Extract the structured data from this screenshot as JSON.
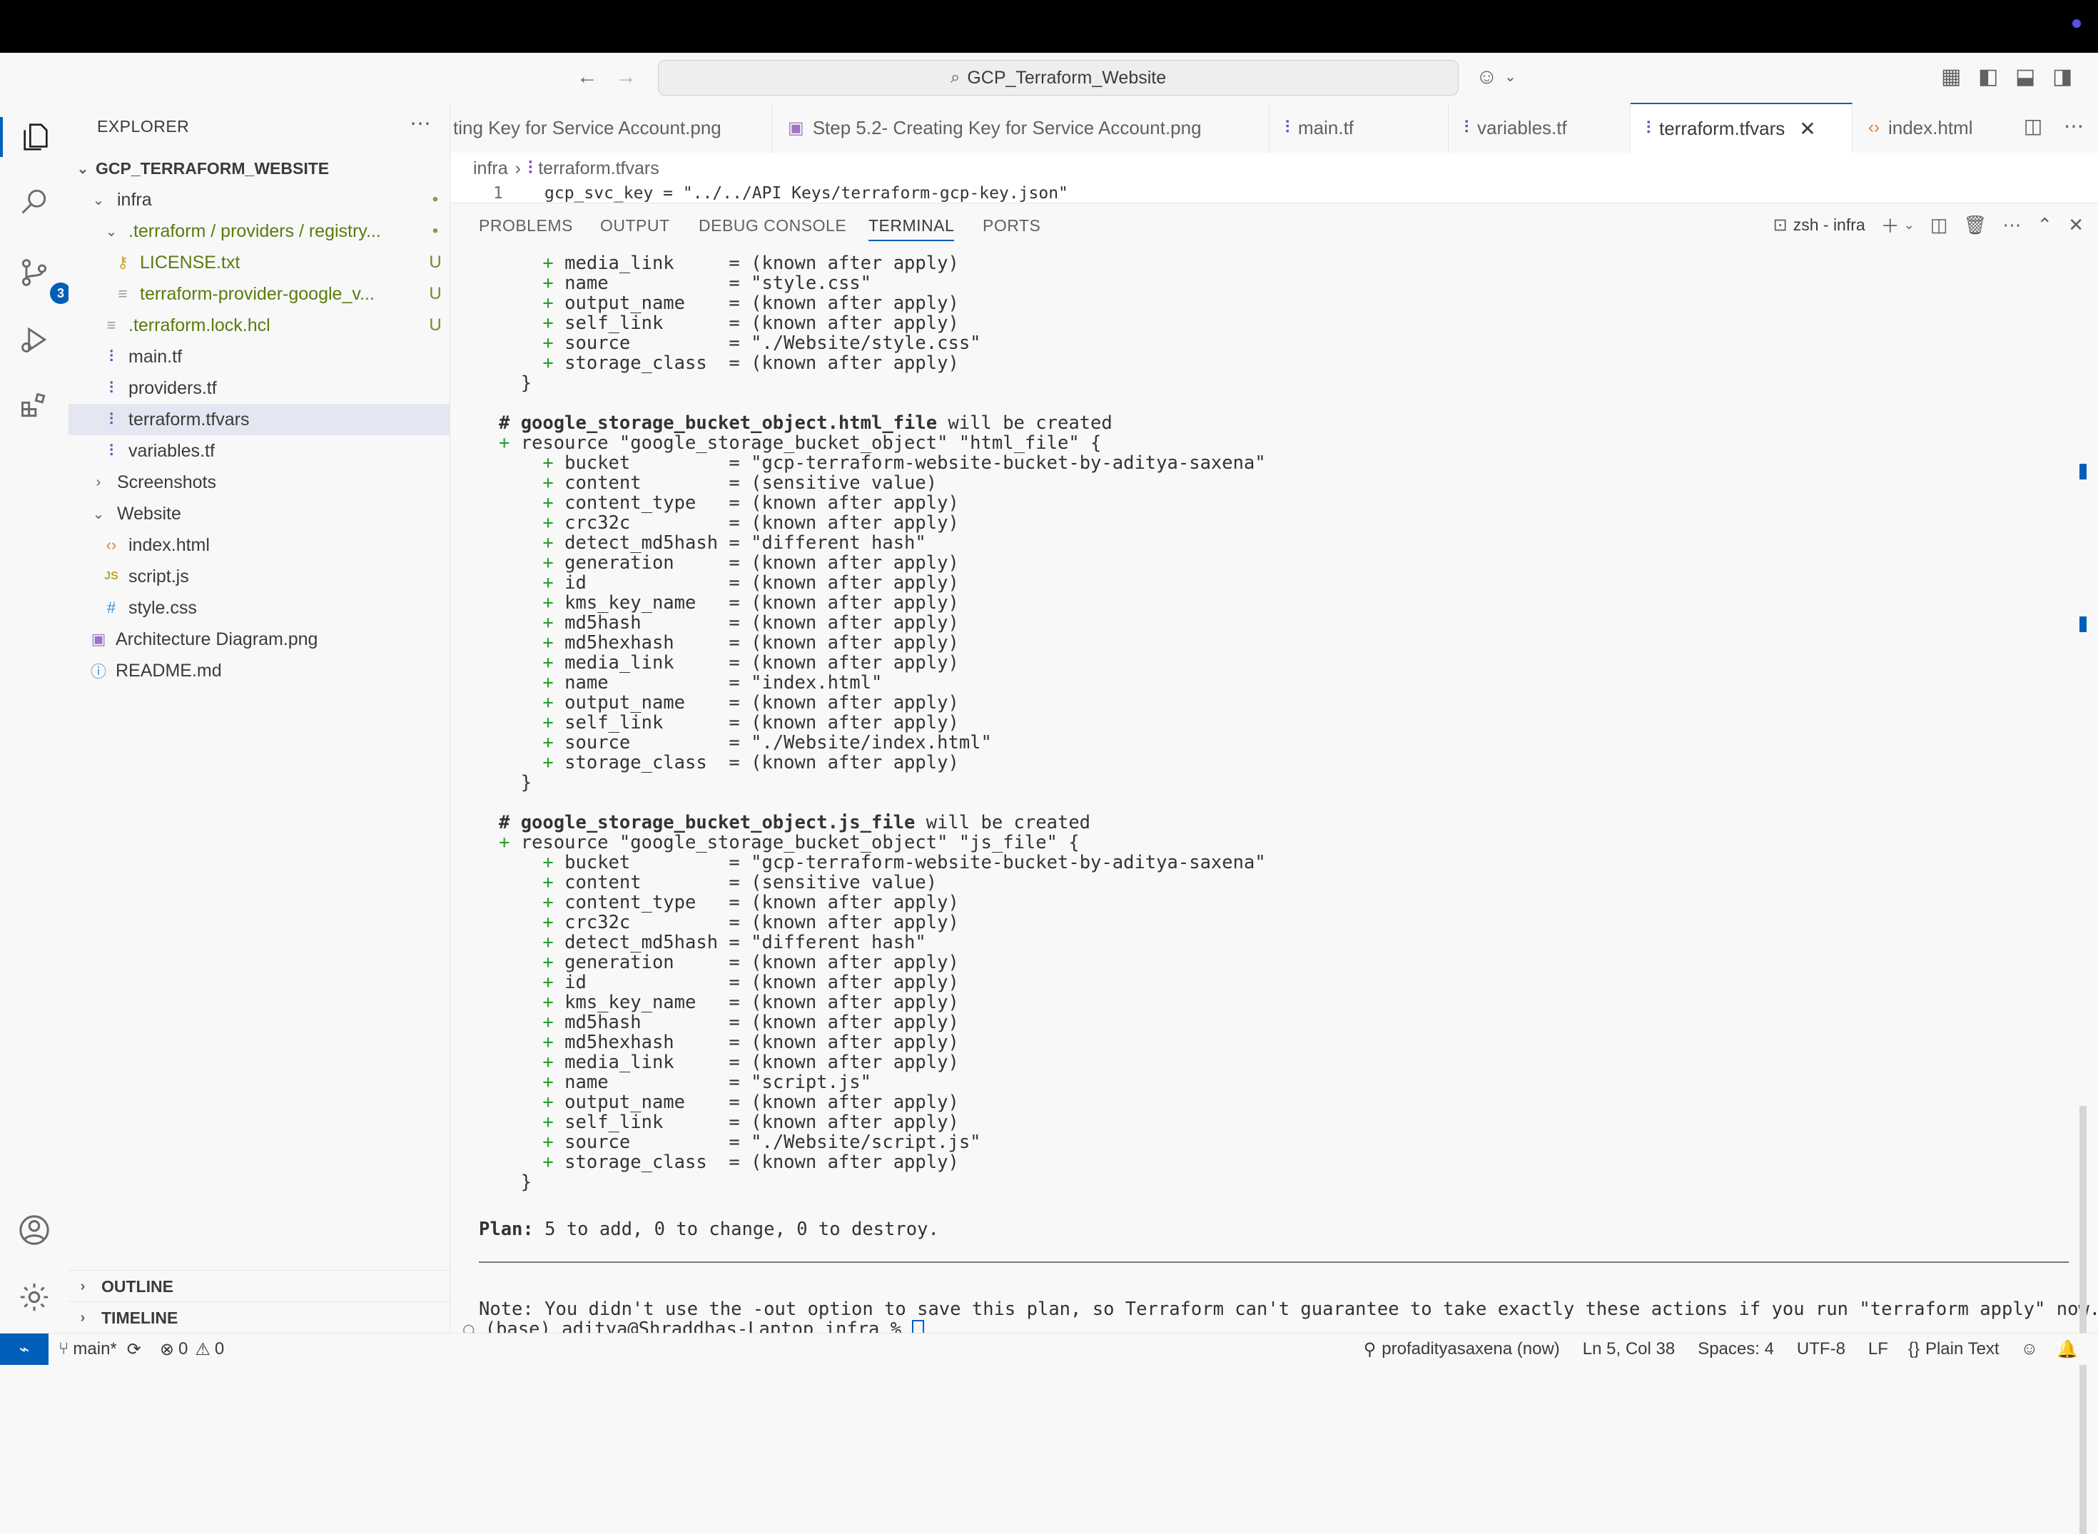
{
  "titlebar": {
    "search_text": "GCP_Terraform_Website"
  },
  "activity": {
    "scm_badge": "3"
  },
  "explorer": {
    "header": "EXPLORER",
    "root": "GCP_TERRAFORM_WEBSITE",
    "items": [
      {
        "label": "infra",
        "status": "•"
      },
      {
        "label": ".terraform / providers / registry...",
        "status": "•"
      },
      {
        "label": "LICENSE.txt",
        "status": "U"
      },
      {
        "label": "terraform-provider-google_v...",
        "status": "U"
      },
      {
        "label": ".terraform.lock.hcl",
        "status": "U"
      },
      {
        "label": "main.tf",
        "status": ""
      },
      {
        "label": "providers.tf",
        "status": ""
      },
      {
        "label": "terraform.tfvars",
        "status": ""
      },
      {
        "label": "variables.tf",
        "status": ""
      },
      {
        "label": "Screenshots",
        "status": ""
      },
      {
        "label": "Website",
        "status": ""
      },
      {
        "label": "index.html",
        "status": ""
      },
      {
        "label": "script.js",
        "status": ""
      },
      {
        "label": "style.css",
        "status": ""
      },
      {
        "label": "Architecture Diagram.png",
        "status": ""
      },
      {
        "label": "README.md",
        "status": ""
      }
    ],
    "outline": "OUTLINE",
    "timeline": "TIMELINE"
  },
  "tabs": [
    "ting Key for Service Account.png",
    "Step 5.2- Creating Key for Service Account.png",
    "main.tf",
    "variables.tf",
    "terraform.tfvars",
    "index.html"
  ],
  "breadcrumb": {
    "folder": "infra",
    "file": "terraform.tfvars"
  },
  "editor": {
    "line_no": "1",
    "line_text": "gcp_svc_key = \"../../API Keys/terraform-gcp-key.json\""
  },
  "panel": {
    "tabs": [
      "PROBLEMS",
      "OUTPUT",
      "DEBUG CONSOLE",
      "TERMINAL",
      "PORTS"
    ],
    "shell": "zsh - infra"
  },
  "terminal": {
    "lines": [
      "    + media_link     = (known after apply)",
      "    + name           = \"style.css\"",
      "    + output_name    = (known after apply)",
      "    + self_link      = (known after apply)",
      "    + source         = \"./Website/style.css\"",
      "    + storage_class  = (known after apply)",
      "  }",
      "",
      "# google_storage_bucket_object.html_file will be created",
      "+ resource \"google_storage_bucket_object\" \"html_file\" {",
      "    + bucket         = \"gcp-terraform-website-bucket-by-aditya-saxena\"",
      "    + content        = (sensitive value)",
      "    + content_type   = (known after apply)",
      "    + crc32c         = (known after apply)",
      "    + detect_md5hash = \"different hash\"",
      "    + generation     = (known after apply)",
      "    + id             = (known after apply)",
      "    + kms_key_name   = (known after apply)",
      "    + md5hash        = (known after apply)",
      "    + md5hexhash     = (known after apply)",
      "    + media_link     = (known after apply)",
      "    + name           = \"index.html\"",
      "    + output_name    = (known after apply)",
      "    + self_link      = (known after apply)",
      "    + source         = \"./Website/index.html\"",
      "    + storage_class  = (known after apply)",
      "  }",
      "",
      "# google_storage_bucket_object.js_file will be created",
      "+ resource \"google_storage_bucket_object\" \"js_file\" {",
      "    + bucket         = \"gcp-terraform-website-bucket-by-aditya-saxena\"",
      "    + content        = (sensitive value)",
      "    + content_type   = (known after apply)",
      "    + crc32c         = (known after apply)",
      "    + detect_md5hash = \"different hash\"",
      "    + generation     = (known after apply)",
      "    + id             = (known after apply)",
      "    + kms_key_name   = (known after apply)",
      "    + md5hash        = (known after apply)",
      "    + md5hexhash     = (known after apply)",
      "    + media_link     = (known after apply)",
      "    + name           = \"script.js\"",
      "    + output_name    = (known after apply)",
      "    + self_link      = (known after apply)",
      "    + source         = \"./Website/script.js\"",
      "    + storage_class  = (known after apply)",
      "  }"
    ],
    "plan": "Plan: 5 to add, 0 to change, 0 to destroy.",
    "note": "Note: You didn't use the -out option to save this plan, so Terraform can't guarantee to take exactly these actions if you run \"terraform apply\" now.",
    "prompt": "(base) aditya@Shraddhas-Laptop infra % "
  },
  "status": {
    "branch": "main*",
    "errors": "0",
    "warnings": "0",
    "user": "profadityasaxena (now)",
    "position": "Ln 5, Col 38",
    "spaces": "Spaces: 4",
    "encoding": "UTF-8",
    "eol": "LF",
    "language": "Plain Text"
  }
}
